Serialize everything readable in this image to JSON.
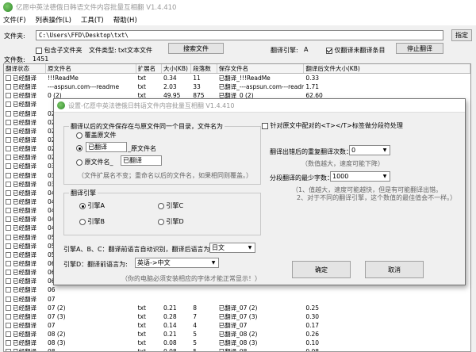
{
  "app": {
    "title": "亿愿中英法德俄日韩语文件内容批量互相翻 V1.4.410"
  },
  "menu": [
    "文件(F)",
    "列表操作(L)",
    "工具(T)",
    "帮助(H)"
  ],
  "folder": {
    "label": "文件夹:",
    "path": "C:\\Users\\FFD\\Desktop\\txt\\",
    "button": "指定"
  },
  "options": {
    "include_sub": "包含子文件夹",
    "file_type_label": "文件类型:",
    "file_type_value": "txt文本文件",
    "search_button": "搜索文件",
    "engine_label": "翻译引擎:",
    "engine_value": "A",
    "only_untranslated": "仅翻译未翻译条目",
    "stop_button": "停止翻译",
    "count_label": "文件数:",
    "count_value": "1451"
  },
  "table": {
    "headers": [
      "翻译状态",
      "原文件名",
      "扩展名",
      "大小(KB)",
      "段落数",
      "保存文件名",
      "翻译后文件大小(KB)"
    ],
    "rows": [
      [
        "已经翻译",
        "!!!ReadMe",
        "txt",
        "0.34",
        "11",
        "已翻译_!!!ReadMe",
        "0.33"
      ],
      [
        "已经翻译",
        "---aspsun.com---readme",
        "txt",
        "2.03",
        "33",
        "已翻译_---aspsun.com---readme",
        "1.71"
      ],
      [
        "已经翻译",
        "0 (2)",
        "txt",
        "49.95",
        "875",
        "已翻译_0 (2)",
        "62.60"
      ],
      [
        "已经翻译",
        "",
        "",
        "",
        "",
        "",
        ""
      ],
      [
        "已经翻译",
        "02",
        "",
        "",
        "",
        "",
        ""
      ],
      [
        "已经翻译",
        "02",
        "",
        "",
        "",
        "",
        ""
      ],
      [
        "已经翻译",
        "02",
        "",
        "",
        "",
        "",
        ""
      ],
      [
        "已经翻译",
        "02",
        "",
        "",
        "",
        "",
        ""
      ],
      [
        "已经翻译",
        "02",
        "",
        "",
        "",
        "",
        ""
      ],
      [
        "已经翻译",
        "02",
        "",
        "",
        "",
        "",
        ""
      ],
      [
        "已经翻译",
        "03",
        "",
        "",
        "",
        "",
        ""
      ],
      [
        "已经翻译",
        "03",
        "",
        "",
        "",
        "",
        ""
      ],
      [
        "已经翻译",
        "03",
        "",
        "",
        "",
        "",
        ""
      ],
      [
        "已经翻译",
        "04",
        "",
        "",
        "",
        "",
        ""
      ],
      [
        "已经翻译",
        "04",
        "",
        "",
        "",
        "",
        ""
      ],
      [
        "已经翻译",
        "04",
        "",
        "",
        "",
        "",
        ""
      ],
      [
        "已经翻译",
        "04",
        "",
        "",
        "",
        "",
        ""
      ],
      [
        "已经翻译",
        "04",
        "",
        "",
        "",
        "",
        ""
      ],
      [
        "已经翻译",
        "05",
        "",
        "",
        "",
        "",
        ""
      ],
      [
        "已经翻译",
        "05",
        "",
        "",
        "",
        "",
        ""
      ],
      [
        "已经翻译",
        "05",
        "",
        "",
        "",
        "",
        ""
      ],
      [
        "已经翻译",
        "06",
        "",
        "",
        "",
        "",
        ""
      ],
      [
        "已经翻译",
        "06",
        "",
        "",
        "",
        "",
        ""
      ],
      [
        "已经翻译",
        "06",
        "",
        "",
        "",
        "",
        ""
      ],
      [
        "已经翻译",
        "06",
        "",
        "",
        "",
        "",
        ""
      ],
      [
        "已经翻译",
        "07",
        "",
        "",
        "",
        "",
        ""
      ],
      [
        "已经翻译",
        "07 (2)",
        "txt",
        "0.21",
        "8",
        "已翻译_07 (2)",
        "0.25"
      ],
      [
        "已经翻译",
        "07 (3)",
        "txt",
        "0.28",
        "7",
        "已翻译_07 (3)",
        "0.30"
      ],
      [
        "已经翻译",
        "07",
        "txt",
        "0.14",
        "4",
        "已翻译_07",
        "0.17"
      ],
      [
        "已经翻译",
        "08 (2)",
        "txt",
        "0.21",
        "5",
        "已翻译_08 (2)",
        "0.26"
      ],
      [
        "已经翻译",
        "08 (3)",
        "txt",
        "0.08",
        "5",
        "已翻译_08 (3)",
        "0.10"
      ],
      [
        "已经翻译",
        "08",
        "txt",
        "0.08",
        "5",
        "已翻译_08",
        "0.08"
      ]
    ]
  },
  "dialog": {
    "title": "设置-亿愿中英法德俄日韩语文件内容批量互相翻 V1.4.410",
    "save_group": "翻译以后的文件保存在与原文件同一个目录，文件名为",
    "opt_overwrite": "覆盖原文件",
    "opt_prefix_value": "已翻译",
    "opt_prefix_suffix": "_原文件名",
    "opt_name_prefix": "原文件名_",
    "opt_name_value": "已翻译",
    "save_note": "（文件扩展名不变；重命名以后的文件名，如果相同则覆盖。）",
    "engine_group": "翻译引擎",
    "engine_a": "引擎A",
    "engine_b": "引擎B",
    "engine_c": "引擎C",
    "engine_d": "引擎D",
    "abc_label": "引擎A、B、C：翻译前语言自动识别，翻译后语言为:",
    "abc_value": "日文",
    "d_label": "引擎D：翻译前语言为:",
    "d_value": "英语->中文",
    "font_note": "（你的电脑必须安装相应的字体才能正常显示！）",
    "tag_check": "针对原文中配对的<T></T>标签做分段符处理",
    "retry_label": "翻译出错后的重复翻译次数：",
    "retry_value": "0",
    "retry_note": "（数值越大，速度可能下降）",
    "seg_label": "分段翻译的最少字数：",
    "seg_value": "1000",
    "seg_note1": "（1、值越大，速度可能越快，但是有可能翻译出错。",
    "seg_note2": "2、对于不同的翻译引擎，这个数值的最佳值会不一样。）",
    "ok_button": "确定",
    "cancel_button": "取消"
  }
}
